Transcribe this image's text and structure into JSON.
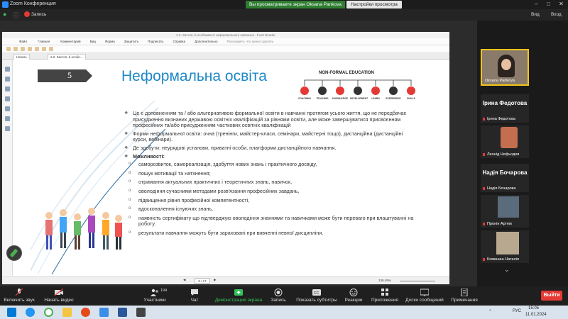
{
  "zoom": {
    "app_title": "Zoom Конференция",
    "share_banner": "Вы просматриваете экран Oksana Pankova",
    "view_settings": "Настройки просмотра",
    "record_label": "Запись",
    "view_label": "Вид",
    "enter_label": "Вход",
    "participants_count": "194",
    "toolbar": {
      "mute": "Включить звук",
      "video": "Начать видео",
      "participants": "Участники",
      "chat": "Чат",
      "share": "Демонстрация экрана",
      "record": "Запись",
      "captions": "Показать субтитры",
      "reactions": "Реакции",
      "apps": "Приложения",
      "whiteboard": "Доски сообщений",
      "notes": "Примечания",
      "leave": "Выйти"
    },
    "gallery": [
      {
        "name": "Oksana Pankova"
      },
      {
        "big_name": "Ірина Федотова",
        "name": "Ірина Федотова"
      },
      {
        "name": "Леонід Нефьодов"
      },
      {
        "big_name": "Надія Бочарова",
        "name": "Надія Бочарова"
      },
      {
        "name": "Пронін Артем"
      },
      {
        "name": "Комишан Наталія"
      }
    ]
  },
  "foxit": {
    "window_title": "2.2. Застоп. й особливості неформального навчання - Foxit Reader",
    "menu": [
      "Файл",
      "Главная",
      "Комментарий",
      "Вид",
      "Форма",
      "Защитить",
      "Подписать",
      "Справка",
      "Дополнительно",
      "Расскажите, что нужно сделать"
    ],
    "tabs": [
      "Начать",
      "2.2. Застоп. й особл..."
    ],
    "page_indicator": "8 / 17",
    "zoom_level": "136.49%"
  },
  "slide": {
    "number": "5",
    "title": "Неформальна освіта",
    "nfe_title": "NON-FORMAL EDUCATION",
    "nfe_items": [
      "COACHING",
      "TEACHING",
      "KNOWLEDGE",
      "DEVELOPMENT",
      "LEARN",
      "EXPERIENCE",
      "SKILLS"
    ],
    "bullets": [
      "Це є доповненням та / або альтернативою формальної освіти в навчанні протягом усього життя, що не передбачає присудження визнаних державою освітніх кваліфікацій за рівнями освіти, але може завершуватися присвоєнням професійних та/або присудженням часткових освітніх кваліфікацій",
      "Форми неформальної освіти: очна (тренінги, майстер-класи, семінари, майстерні тощо), дистанційна (дистанційні курси, вебінари).",
      "Де здобути: неурядові установи, приватні особи, платформи дистанційного навчання."
    ],
    "opportunities_label": "Можливості:",
    "sub_bullets": [
      "саморозвиток, самореалізація, здобуття нових знань і практичного досвіду,",
      "пошук мотивації та натхнення;",
      "отримання актуальних практичних і теоретичних знань, навичок,",
      "оволодіння сучасними методами розв'язання професійних завдань,",
      "підвищення рівня професійної компетентності,",
      "вдосконалення існуючих знань,",
      "наявність сертифікату що підтверджую оволодіння знаннями та навичками може бути переваго при влаштуванні на роботу.",
      "результати навчання можуть бути зараховані при вивченні певної дисципліни."
    ]
  },
  "taskbar": {
    "time": "15:05",
    "date": "11.01.2024",
    "lang": "РУС"
  }
}
